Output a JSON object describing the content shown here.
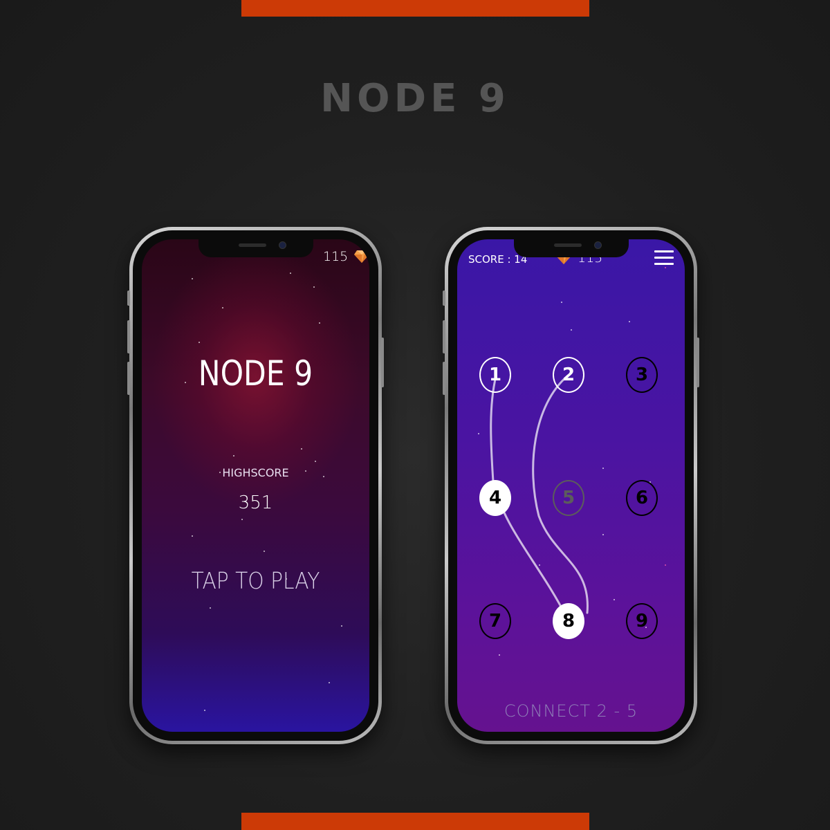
{
  "page": {
    "title": "NODE 9"
  },
  "colors": {
    "accent": "#cc3a06",
    "gem": "#f5a24a",
    "home_bg": "#3d0a2a",
    "game_bg": "#4a14a2"
  },
  "home_screen": {
    "gems": "115",
    "gem_icon": "diamond-icon",
    "title": "NODE 9",
    "highscore_label": "HIGHSCORE",
    "highscore_value": "351",
    "play_label": "TAP TO PLAY"
  },
  "game_screen": {
    "score": "SCORE : 14",
    "gems": "115",
    "gem_icon": "diamond-icon",
    "menu_icon": "hamburger-menu-icon",
    "nodes": [
      {
        "label": "1",
        "state": "outline-white"
      },
      {
        "label": "2",
        "state": "outline-white"
      },
      {
        "label": "3",
        "state": "outline"
      },
      {
        "label": "4",
        "state": "filled"
      },
      {
        "label": "5",
        "state": "dim"
      },
      {
        "label": "6",
        "state": "outline"
      },
      {
        "label": "7",
        "state": "outline"
      },
      {
        "label": "8",
        "state": "filled"
      },
      {
        "label": "9",
        "state": "outline"
      }
    ],
    "instruction": "CONNECT  2  -  5"
  }
}
